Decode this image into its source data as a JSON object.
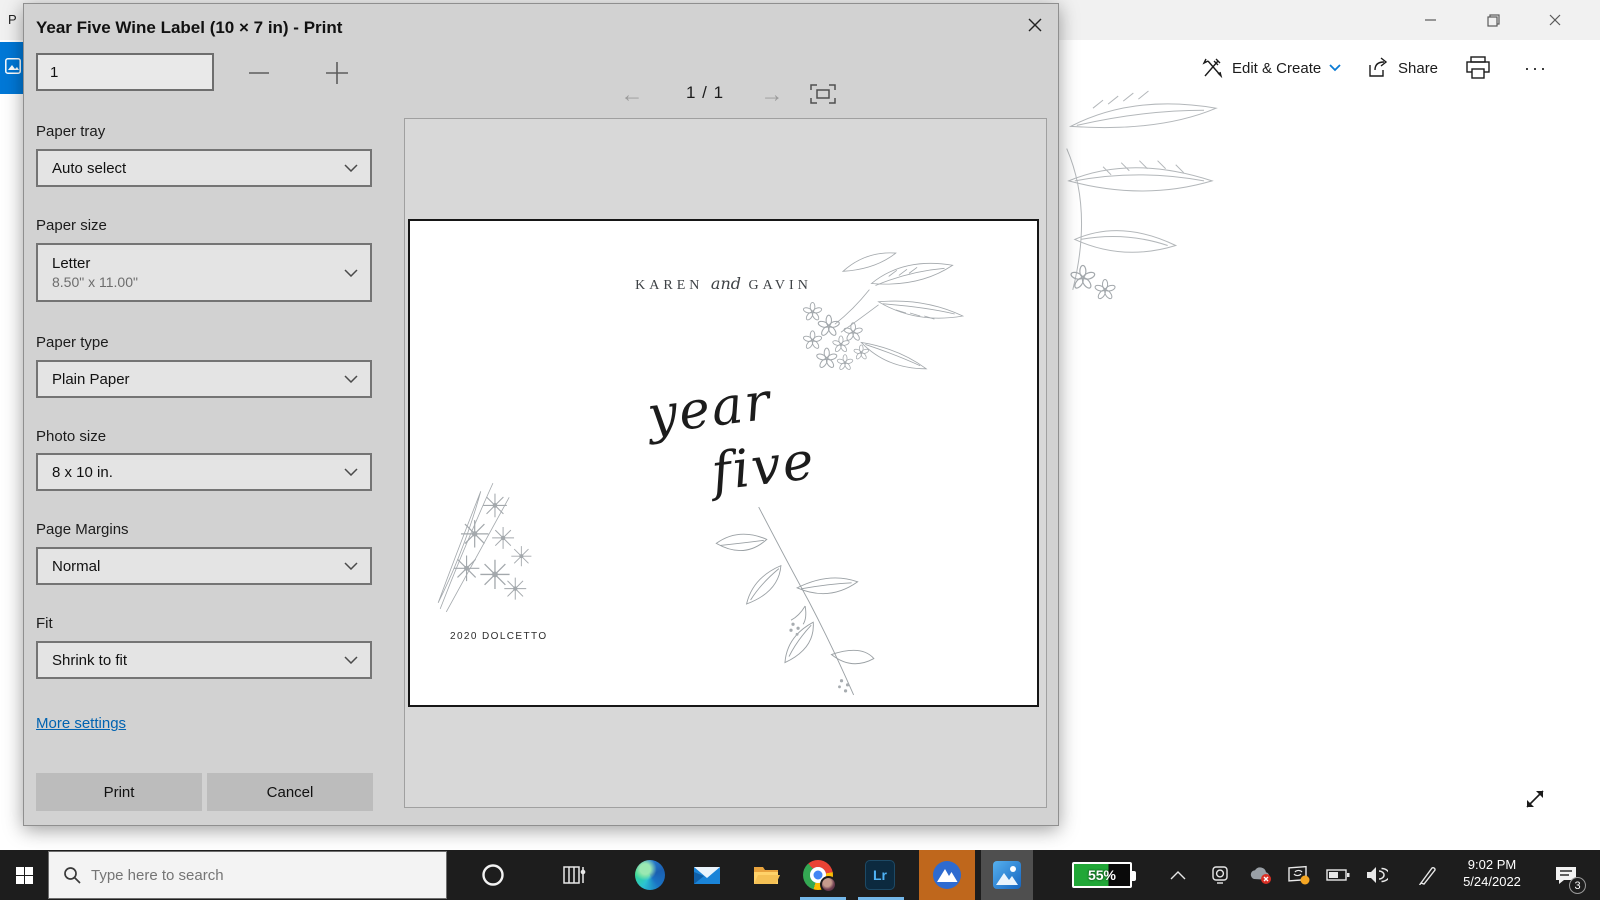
{
  "app": {
    "title_partial": "P",
    "toolbar": {
      "edit_create": "Edit & Create",
      "share": "Share",
      "more_label": "···"
    }
  },
  "dialog": {
    "title": "Year Five Wine Label (10 × 7 in) - Print",
    "copies_value": "1",
    "fields": [
      {
        "label": "Paper tray",
        "value": "Auto select"
      },
      {
        "label": "Paper size",
        "value": "Letter",
        "sub": "8.50\" x 11.00\""
      },
      {
        "label": "Paper type",
        "value": "Plain Paper"
      },
      {
        "label": "Photo size",
        "value": "8 x 10 in."
      },
      {
        "label": "Page Margins",
        "value": "Normal"
      },
      {
        "label": "Fit",
        "value": "Shrink to fit"
      }
    ],
    "more_settings": "More settings",
    "print_label": "Print",
    "cancel_label": "Cancel",
    "nav": {
      "page_indicator": "1 / 1"
    }
  },
  "preview": {
    "names": {
      "left": "KAREN",
      "joiner": "and",
      "right": "GAVIN"
    },
    "script": {
      "line1": "year",
      "line2": "five"
    },
    "vintage": "2020 DOLCETTO"
  },
  "taskbar": {
    "search_placeholder": "Type here to search",
    "lr_label": "Lr",
    "battery_percent": "55%",
    "clock": {
      "time": "9:02 PM",
      "date": "5/24/2022"
    },
    "notification_count": "3"
  },
  "colors": {
    "accent": "#0078d7",
    "link_blue": "#0063b1",
    "running_indicator": "#74b8ea",
    "nord_orange": "#bf671c",
    "battery_green": "#21a737",
    "taskbar_bg": "#1d1d1d",
    "dialog_bg": "#d2d2d2"
  }
}
